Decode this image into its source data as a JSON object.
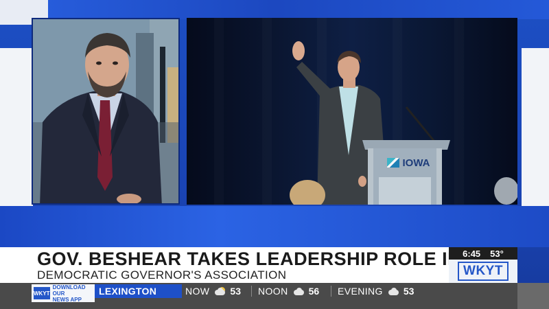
{
  "lower_third": {
    "headline": "GOV. BESHEAR TAKES LEADERSHIP ROLE IN DGA",
    "subheadline": "DEMOCRATIC GOVERNOR'S ASSOCIATION"
  },
  "time_weather": {
    "time": "6:45",
    "temperature": "53°"
  },
  "station": {
    "logo_text": "WKYT"
  },
  "podium_sign": "IOWA",
  "app_promo": {
    "logo_text": "WKYT",
    "line1": "DOWNLOAD OUR",
    "line2": "NEWS APP"
  },
  "ticker": {
    "city": "LEXINGTON",
    "now_label": "NOW",
    "now_temp": "53",
    "noon_label": "NOON",
    "noon_temp": "56",
    "evening_label": "EVENING",
    "evening_temp": "53"
  },
  "colors": {
    "accent_blue": "#1e50c8",
    "background_blue": "#1a44b4",
    "ticker_gray": "#4a4a4a"
  }
}
